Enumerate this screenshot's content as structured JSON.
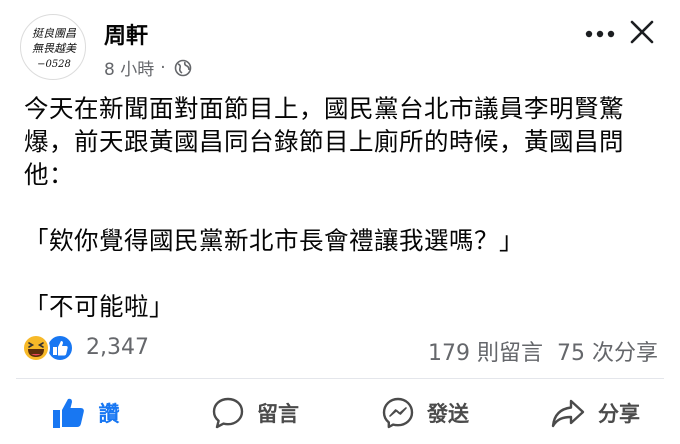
{
  "post": {
    "author": "周軒",
    "time": "8 小時",
    "separator": "·",
    "avatar_lines": [
      "挺良團昌",
      "無畏越美",
      "−0528"
    ],
    "paragraphs": [
      "今天在新聞面對面節目上，國民黨台北市議員李明賢驚爆，前天跟黃國昌同台錄節目上廁所的時候，黃國昌問他：",
      "「欸你覺得國民黨新北市長會禮讓我選嗎？」",
      "「不可能啦」"
    ]
  },
  "stats": {
    "reaction_count": "2,347",
    "comments": "179 則留言",
    "shares": "75 次分享",
    "reaction_icons": [
      "haha-icon",
      "like-icon"
    ]
  },
  "actions": {
    "like": "讚",
    "comment": "留言",
    "send": "發送",
    "share": "分享"
  },
  "colors": {
    "accent": "#1877f2",
    "secondary_text": "#65676b",
    "haha": "#f7b928"
  }
}
